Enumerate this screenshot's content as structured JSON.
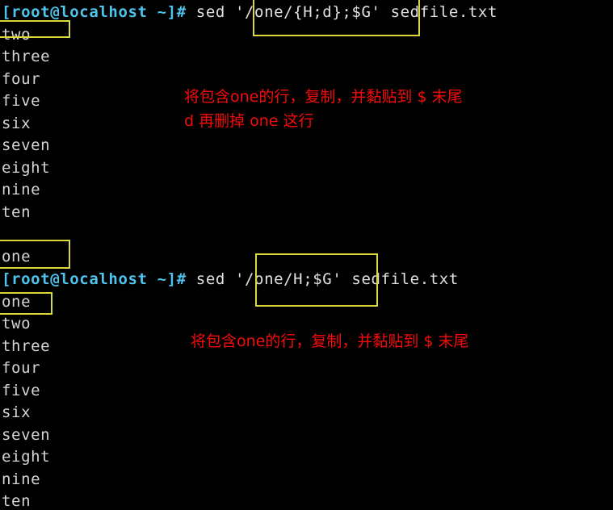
{
  "terminal": {
    "background_color": "#000000",
    "foreground_color": "#d8d8d8",
    "prompt_color": "#4ec3ec",
    "highlight_box_color": "#d9d93b",
    "annotation_color": "#f50b0b"
  },
  "session": {
    "blocks": [
      {
        "prompt": "[root@localhost ~]#",
        "command_prefix": " sed ",
        "command_expression": "'/one/{H;d};$G'",
        "command_suffix": " sedfile.txt",
        "output": [
          "two",
          "three",
          "four",
          "five",
          "six",
          "seven",
          "eight",
          "nine",
          "ten",
          "",
          "one"
        ]
      },
      {
        "prompt": "[root@localhost ~]#",
        "command_prefix": " sed ",
        "command_expression": "'/one/H;$G'",
        "command_suffix": " sedfile.txt",
        "output": [
          "one",
          "two",
          "three",
          "four",
          "five",
          "six",
          "seven",
          "eight",
          "nine",
          "ten"
        ]
      }
    ]
  },
  "annotations": [
    {
      "id": "annotation-1-line-1",
      "text": "将包含one的行，复制，并黏贴到 $ 末尾"
    },
    {
      "id": "annotation-1-line-2",
      "text": "d 再删掉 one 这行"
    },
    {
      "id": "annotation-2-line-1",
      "text": "将包含one的行，复制，并黏贴到 $ 末尾"
    }
  ],
  "highlights": [
    {
      "id": "highlight-cmd-1",
      "label": "'/one/{H;d};$G'"
    },
    {
      "id": "highlight-cmd-2",
      "label": "'/one/H;$G'"
    },
    {
      "id": "highlight-prompt-1-underline",
      "label": "[root@localhost ~]#"
    },
    {
      "id": "highlight-output-one-appended",
      "label": "one"
    },
    {
      "id": "highlight-output-one-first",
      "label": "one"
    }
  ]
}
